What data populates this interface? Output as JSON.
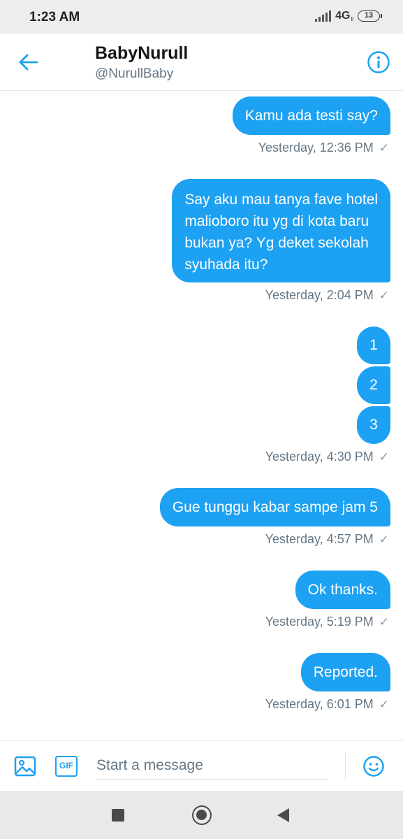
{
  "status_bar": {
    "time": "1:23 AM",
    "network": "4G",
    "network_sub": "ll",
    "battery": "13"
  },
  "header": {
    "name": "BabyNurull",
    "handle": "@NurullBaby"
  },
  "messages": [
    {
      "text": "Kamu ada testi say?",
      "timestamp": "Yesterday, 12:36 PM"
    },
    {
      "text_lines": [
        "Say aku mau tanya fave hotel",
        "malioboro itu yg di kota baru",
        "bukan ya? Yg deket sekolah",
        "syuhada itu?"
      ],
      "timestamp": "Yesterday, 2:04 PM"
    },
    {
      "stack": [
        "1",
        "2",
        "3"
      ],
      "timestamp": "Yesterday, 4:30 PM"
    },
    {
      "text": "Gue tunggu kabar sampe jam 5",
      "timestamp": "Yesterday, 4:57 PM"
    },
    {
      "text": "Ok thanks.",
      "timestamp": "Yesterday, 5:19 PM"
    },
    {
      "text": "Reported.",
      "timestamp": "Yesterday, 6:01 PM"
    }
  ],
  "check_glyph": "✓",
  "composer": {
    "placeholder": "Start a message",
    "gif_label": "GIF"
  },
  "colors": {
    "accent": "#1da1f2",
    "muted_text": "#657786"
  }
}
